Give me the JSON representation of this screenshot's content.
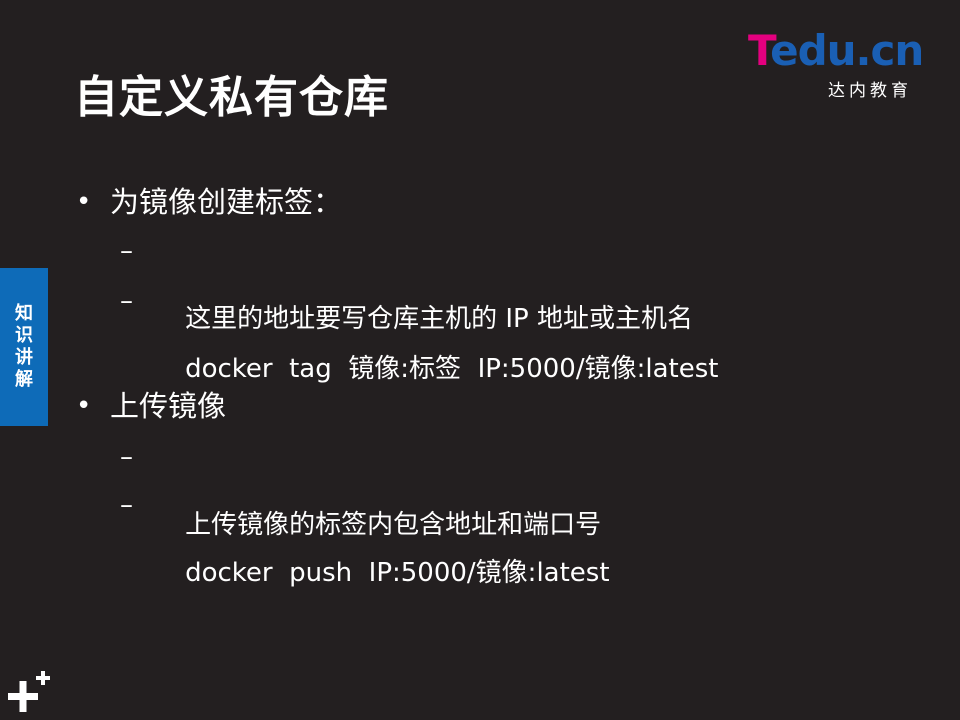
{
  "slide": {
    "title": "自定义私有仓库",
    "side_tab": [
      "知",
      "识",
      "讲",
      "解"
    ]
  },
  "logo": {
    "brand_t": "T",
    "brand_rest": "edu.cn",
    "subtitle": "达内教育"
  },
  "sections": [
    {
      "heading": "为镜像创建标签：",
      "items": [
        "这里的地址要写仓库主机的 IP 地址或主机名",
        "docker  tag  镜像:标签  IP:5000/镜像:latest"
      ]
    },
    {
      "heading": "上传镜像",
      "items": [
        "上传镜像的标签内包含地址和端口号",
        "docker  push  IP:5000/镜像:latest"
      ]
    }
  ],
  "symbols": {
    "bullet": "•",
    "dash": "–"
  },
  "colors": {
    "background": "#231f20",
    "side_tab": "#0e6bb8",
    "logo_magenta": "#e4007f",
    "logo_blue": "#1a5fb4"
  },
  "icons": {
    "corner": "plus-plus-icon"
  }
}
